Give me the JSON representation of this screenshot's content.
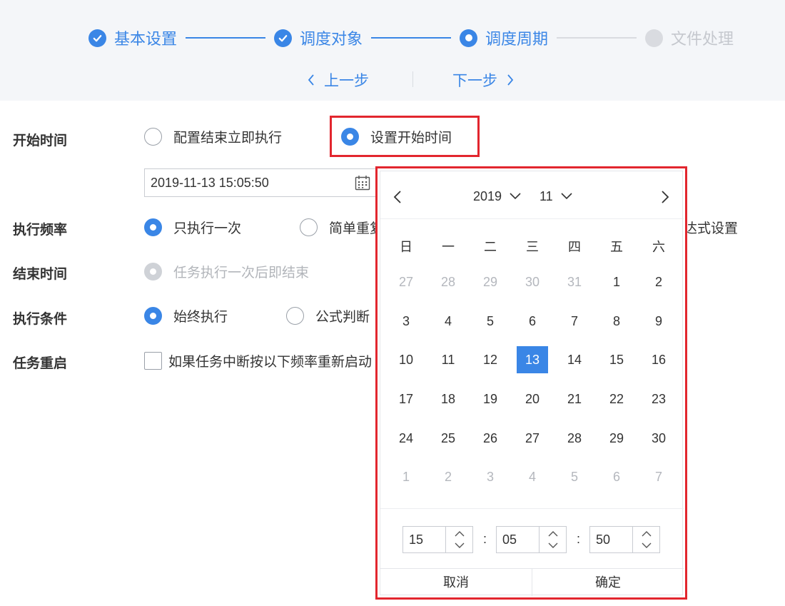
{
  "steps": [
    {
      "label": "基本设置",
      "state": "done"
    },
    {
      "label": "调度对象",
      "state": "done"
    },
    {
      "label": "调度周期",
      "state": "current"
    },
    {
      "label": "文件处理",
      "state": "pending"
    }
  ],
  "nav": {
    "prev_label": "上一步",
    "next_label": "下一步"
  },
  "form": {
    "start_time": {
      "label": "开始时间",
      "option_a": "配置结束立即执行",
      "option_b": "设置开始时间",
      "selected": "option_b",
      "datetime_value": "2019-11-13 15:05:50"
    },
    "frequency": {
      "label": "执行频率",
      "option_a": "只执行一次",
      "option_b_visible": "简单重复",
      "option_c_visible": "达式设置",
      "selected": "option_a"
    },
    "end_time": {
      "label": "结束时间",
      "option_a": "任务执行一次后即结束",
      "disabled": true
    },
    "condition": {
      "label": "执行条件",
      "option_a": "始终执行",
      "option_b": "公式判断",
      "selected": "option_a"
    },
    "restart": {
      "label": "任务重启",
      "checkbox_text": "如果任务中断按以下频率重新启动",
      "checked": false
    }
  },
  "date_picker": {
    "year": "2019",
    "month": "11",
    "weekdays": [
      "日",
      "一",
      "二",
      "三",
      "四",
      "五",
      "六"
    ],
    "weeks": [
      [
        "27",
        "28",
        "29",
        "30",
        "31",
        "1",
        "2"
      ],
      [
        "3",
        "4",
        "5",
        "6",
        "7",
        "8",
        "9"
      ],
      [
        "10",
        "11",
        "12",
        "13",
        "14",
        "15",
        "16"
      ],
      [
        "17",
        "18",
        "19",
        "20",
        "21",
        "22",
        "23"
      ],
      [
        "24",
        "25",
        "26",
        "27",
        "28",
        "29",
        "30"
      ],
      [
        "1",
        "2",
        "3",
        "4",
        "5",
        "6",
        "7"
      ]
    ],
    "selected_day": "13",
    "time": {
      "hour": "15",
      "minute": "05",
      "second": "50",
      "separator": ":"
    },
    "cancel_label": "取消",
    "confirm_label": "确定"
  },
  "colors": {
    "accent": "#3a86e6",
    "highlight": "#e2262e",
    "muted": "#b4b7bd"
  }
}
